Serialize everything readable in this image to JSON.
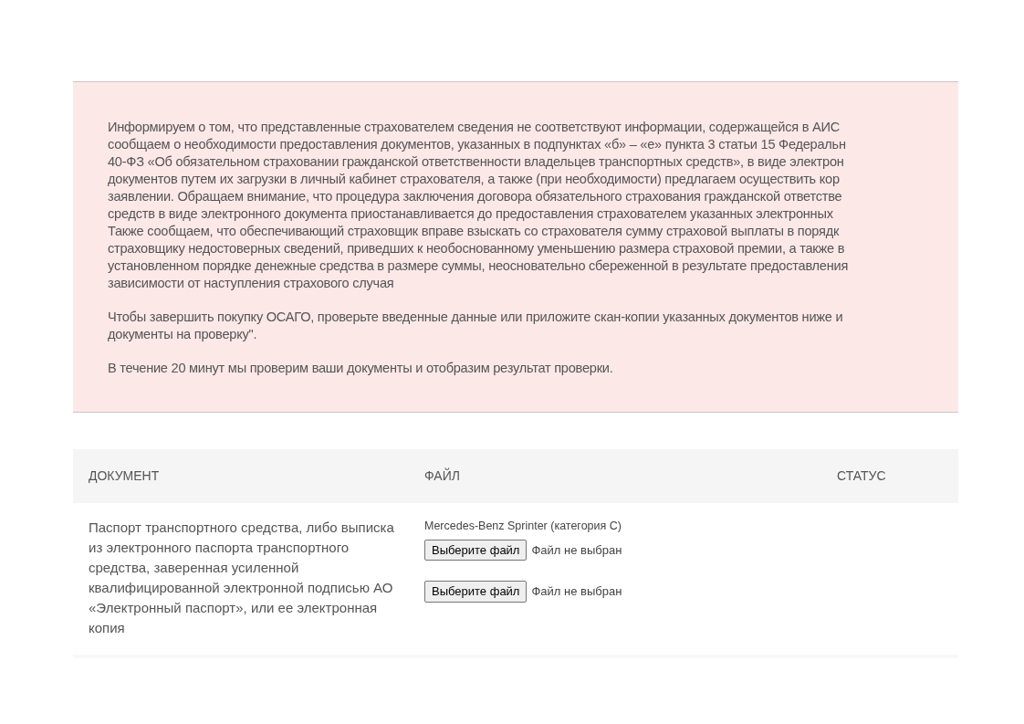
{
  "notice": {
    "paragraphs": [
      [
        "Информируем о том, что представленные страхователем сведения не соответствуют информации, содержащейся в АИС",
        "сообщаем о необходимости предоставления документов, указанных в подпунктах «б» – «е» пункта 3 статьи 15 Федеральн",
        "40-ФЗ «Об обязательном страховании гражданской ответственности владельцев транспортных средств», в виде электрон",
        "документов путем их загрузки в личный кабинет страхователя, а также (при необходимости) предлагаем осуществить кор",
        "заявлении. Обращаем внимание, что процедура заключения договора обязательного страхования гражданской ответстве",
        "средств в виде электронного документа приостанавливается до предоставления страхователем указанных электронных",
        "Также сообщаем, что обеспечивающий страховщик вправе взыскать со страхователя сумму страховой выплаты в порядк",
        "страховщику недостоверных сведений, приведших к необоснованному уменьшению размера страховой премии, а также в",
        "установленном порядке денежные средства в размере суммы, неосновательно сбереженной в результате предоставления",
        "зависимости от наступления страхового случая"
      ],
      [
        "Чтобы завершить покупку ОСАГО, проверьте введенные данные или приложите скан-копии указанных документов ниже и",
        "документы на проверку\"."
      ],
      [
        "В течение 20 минут мы проверим ваши документы и отобразим результат проверки."
      ]
    ]
  },
  "table": {
    "columns": [
      "ДОКУМЕНТ",
      "ФАЙЛ",
      "СТАТУС"
    ],
    "rows": [
      {
        "document": "Паспорт транспортного средства, либо выписка из электронного паспорта транспортного средства, заверенная усиленной квалифицированной электронной подписью АО «Электронный паспорт», или ее электронная копия",
        "vehicle": "Mercedes-Benz Sprinter (категория С)",
        "uploads": [
          {
            "button": "Выберите файл",
            "file_status": "Файл не выбран"
          },
          {
            "button": "Выберите файл",
            "file_status": "Файл не выбран"
          }
        ]
      }
    ]
  }
}
